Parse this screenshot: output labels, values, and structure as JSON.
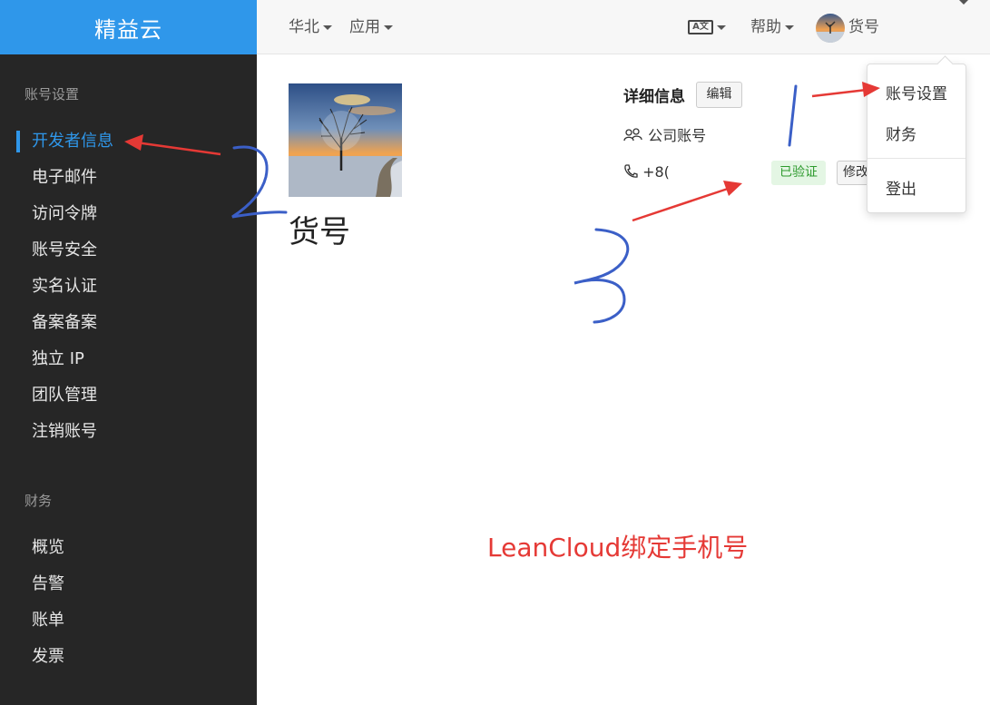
{
  "brand": "精益云",
  "sidebar": {
    "groups": [
      {
        "title": "账号设置",
        "items": [
          "开发者信息",
          "电子邮件",
          "访问令牌",
          "账号安全",
          "实名认证",
          "备案备案",
          "独立 IP",
          "团队管理",
          "注销账号"
        ]
      },
      {
        "title": "财务",
        "items": [
          "概览",
          "告警",
          "账单",
          "发票"
        ]
      }
    ],
    "active_item": "开发者信息"
  },
  "topbar": {
    "region": "华北",
    "apps": "应用",
    "help": "帮助",
    "user": "货号"
  },
  "profile": {
    "username": "货号",
    "detail_title": "详细信息",
    "edit_label": "编辑",
    "account_type": "公司账号",
    "phone": "+8(",
    "verified_label": "已验证",
    "modify_label": "修改"
  },
  "dropdown": {
    "items": [
      "账号设置",
      "财务",
      "登出"
    ]
  },
  "annotations": {
    "caption": "LeanCloud绑定手机号"
  },
  "colors": {
    "accent": "#2f97ea",
    "sidebar_bg": "#262626",
    "verified_bg": "#e4f6e4",
    "verified_text": "#2e9b2e",
    "annotation_red": "#e53935",
    "annotation_blue": "#3b5fc7"
  }
}
